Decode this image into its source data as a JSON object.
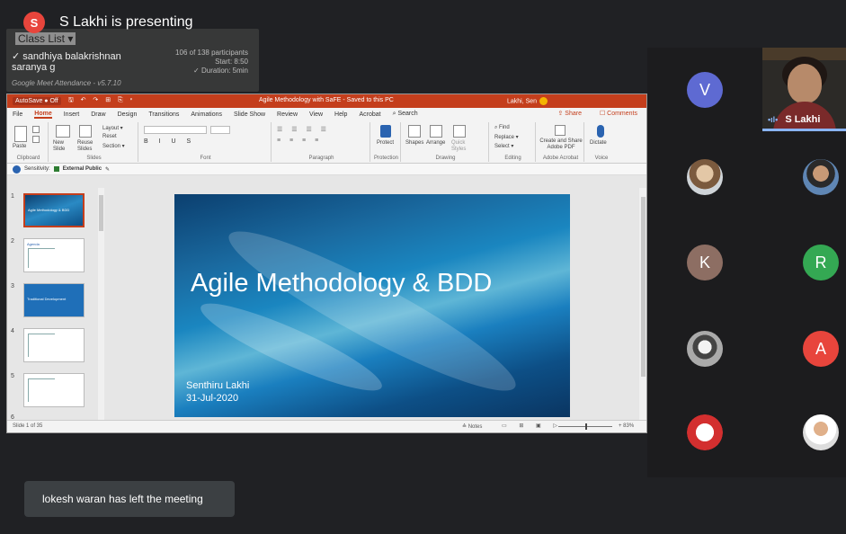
{
  "presenter": {
    "initial": "S",
    "text": "S Lakhi is presenting",
    "color": "#e8453c"
  },
  "class_list": {
    "title": "Class List",
    "line1": "✓ sandhiya balakrishnan",
    "line2": "saranya g",
    "stats1": "106 of 138 participants",
    "stats2": "Start: 8:50",
    "stats3": "✓ Duration: 5min",
    "footer": "Google Meet Attendance - v5.7.10"
  },
  "ppt": {
    "autosave": "AutoSave ● Off",
    "qat": "🖫 ↶ ↷ ⊞ ⎘ ▾",
    "title": "Agile Methodology with SaFE  -  Saved to this PC",
    "user": "Lakhi, Sen",
    "tabs": [
      "File",
      "Home",
      "Insert",
      "Draw",
      "Design",
      "Transitions",
      "Animations",
      "Slide Show",
      "Review",
      "View",
      "Help",
      "Acrobat",
      "⌕ Search"
    ],
    "share": "⇪ Share",
    "comments": "☐ Comments",
    "ribbon_groups": [
      "Clipboard",
      "Slides",
      "Font",
      "Paragraph",
      "Protection",
      "Drawing",
      "Editing",
      "Adobe Acrobat",
      "Voice"
    ],
    "ribbon_buttons": {
      "paste": "Paste",
      "new_slide": "New Slide",
      "reuse": "Reuse Slides",
      "layout": "Layout ▾",
      "reset": "Reset",
      "section": "Section ▾",
      "protect": "Protect",
      "shapes": "Shapes",
      "arrange": "Arrange",
      "quick_styles": "Quick Styles",
      "find": "⌕ Find",
      "replace": "Replace ▾",
      "select": "Select ▾",
      "create_pdf": "Create and Share Adobe PDF",
      "dictate": "Dictate"
    },
    "sensitivity_label": "Sensitivity:",
    "sensitivity_value": "External Public",
    "thumbnails": [
      {
        "num": "1",
        "title": "Agile Methodology & BDD"
      },
      {
        "num": "2",
        "title": "Agenda"
      },
      {
        "num": "3",
        "title": "Traditional Development"
      },
      {
        "num": "4",
        "title": ""
      },
      {
        "num": "5",
        "title": ""
      },
      {
        "num": "6",
        "title": ""
      }
    ],
    "slide": {
      "title": "Agile Methodology & BDD",
      "author": "Senthiru Lakhi",
      "date": "31-Jul-2020"
    },
    "status": {
      "slide_info": "Slide 1 of 35",
      "notes": "≙ Notes",
      "zoom": "+ 83%"
    }
  },
  "participants": [
    {
      "initial": "V",
      "color": "#5e6ad2"
    },
    {
      "initial": "K",
      "color": "#8d6e63"
    },
    {
      "initial": "R",
      "color": "#34a853"
    },
    {
      "initial": "A",
      "color": "#e8453c"
    }
  ],
  "video": {
    "name": "S Lakhi",
    "mic": "•ıl•"
  },
  "toast": "lokesh waran has left the meeting"
}
